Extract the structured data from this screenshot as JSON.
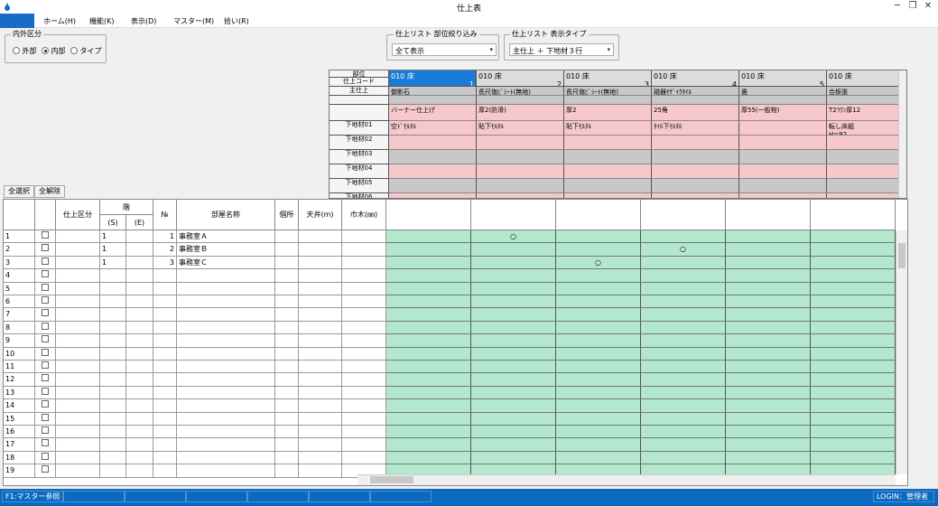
{
  "window": {
    "title": "仕上表"
  },
  "menu": [
    {
      "label": "ホーム(H)"
    },
    {
      "label": "機能(K)"
    },
    {
      "label": "表示(D)"
    },
    {
      "label": "マスター(M)"
    },
    {
      "label": "拾い(R)"
    }
  ],
  "inout": {
    "legend": "内外区分",
    "options": [
      {
        "label": "外部",
        "selected": false
      },
      {
        "label": "内部",
        "selected": true
      },
      {
        "label": "タイプ",
        "selected": false
      }
    ]
  },
  "filter": {
    "legend": "仕上リスト 部位絞り込み",
    "value": "全て表示"
  },
  "viewtype": {
    "legend": "仕上リスト 表示タイプ",
    "value": "主仕上 ＋ 下地材３行"
  },
  "buttons": {
    "select_all": "全選択",
    "clear_all": "全解除"
  },
  "finish_header": {
    "row_labels": [
      "部位",
      "仕上コード",
      "主仕上",
      "",
      "",
      "下地材01",
      "下地材02",
      "下地材03",
      "下地材04",
      "下地材05",
      "下地材06"
    ],
    "columns": [
      {
        "part": "010 床",
        "code": "1",
        "main": "御影石",
        "sub1": "バーナー仕上げ",
        "sub2": "空ﾄﾞﾓﾙﾀﾙ",
        "sub2b": ""
      },
      {
        "part": "010 床",
        "code": "2",
        "main": "長尺塩ﾋﾞｼｰﾄ(無地)",
        "sub1": "厚2(防滑)",
        "sub2": "貼下ﾓﾙﾀﾙ",
        "sub2b": ""
      },
      {
        "part": "010 床",
        "code": "3",
        "main": "長尺塩ﾋﾞｼｰﾄ(無地)",
        "sub1": "厚2",
        "sub2": "貼下ﾓﾙﾀﾙ",
        "sub2b": ""
      },
      {
        "part": "010 床",
        "code": "4",
        "main": "磁器ﾓｻﾞｲｸﾀｲﾙ",
        "sub1": "25角",
        "sub2": "ﾀｲﾙ下ﾓﾙﾀﾙ",
        "sub2b": ""
      },
      {
        "part": "010 床",
        "code": "5",
        "main": "畳",
        "sub1": "厚55(一般物)",
        "sub2": "",
        "sub2b": ""
      },
      {
        "part": "010 床",
        "code": "",
        "main": "合板張",
        "sub1": "T2ﾗﾜﾝ厚12",
        "sub2": "転し床組",
        "sub2b": "H=92"
      }
    ]
  },
  "grid": {
    "headers": {
      "kubun": "仕上区分",
      "floor": "階",
      "floor_s": "(S)",
      "floor_e": "(E)",
      "no": "№",
      "room": "部屋名称",
      "place": "個所",
      "ceiling": "天井(m)",
      "baseboard": "巾木(㎜)"
    },
    "rows": [
      {
        "n": "1",
        "s": "1",
        "no": "1",
        "room": "事務室Ａ",
        "mark_col": 1
      },
      {
        "n": "2",
        "s": "1",
        "no": "2",
        "room": "事務室Ｂ",
        "mark_col": 3
      },
      {
        "n": "3",
        "s": "1",
        "no": "3",
        "room": "事務室Ｃ",
        "mark_col": 2
      },
      {
        "n": "4"
      },
      {
        "n": "5"
      },
      {
        "n": "6"
      },
      {
        "n": "7"
      },
      {
        "n": "8"
      },
      {
        "n": "9"
      },
      {
        "n": "10"
      },
      {
        "n": "11"
      },
      {
        "n": "12"
      },
      {
        "n": "13"
      },
      {
        "n": "14"
      },
      {
        "n": "15"
      },
      {
        "n": "16"
      },
      {
        "n": "17"
      },
      {
        "n": "18"
      },
      {
        "n": "19"
      }
    ],
    "mark_symbol": "○"
  },
  "status": {
    "f1": "F1:マスター参照",
    "login": "LOGIN：管理者"
  },
  "colors": {
    "menu_accent": "#1a6bc7",
    "pink": "#f6c8cc",
    "gray": "#c8c8c8",
    "green": "#b3e8cf",
    "status": "#0a6ac0"
  }
}
